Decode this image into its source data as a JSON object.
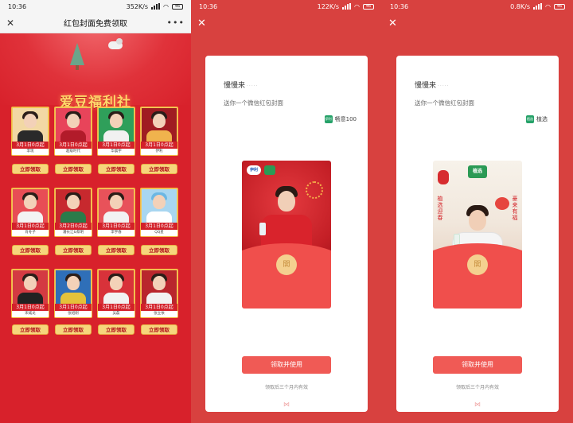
{
  "panels": {
    "left": {
      "status": {
        "time": "10:36",
        "speed": "352K/s",
        "battery": "46"
      },
      "title": "红包封面免费领取",
      "hero_title": "爱豆福利社",
      "cards": [
        {
          "date": "3月1日0点起",
          "name": "李现",
          "claim": "立即领取"
        },
        {
          "date": "3月1日0点起",
          "name": "超级时代",
          "claim": "立即领取"
        },
        {
          "date": "3月1日0点起",
          "name": "华晨宇",
          "claim": "立即领取"
        },
        {
          "date": "3月1日0点起",
          "name": "伊利",
          "claim": "立即领取"
        },
        {
          "date": "3月1日0点起",
          "name": "肖冬子",
          "claim": "立即领取"
        },
        {
          "date": "3月2日0点起",
          "name": "潘长江&蔡明",
          "claim": "立即领取"
        },
        {
          "date": "3月1日0点起",
          "name": "李宇春",
          "claim": "立即领取"
        },
        {
          "date": "3月1日0点起",
          "name": "QQ星",
          "claim": "立即领取"
        },
        {
          "date": "3月1日0点起",
          "name": "宋威龙",
          "claim": "立即领取"
        },
        {
          "date": "3月1日0点起",
          "name": "张绍刚",
          "claim": "立即领取"
        },
        {
          "date": "3月1日0点起",
          "name": "吴磊",
          "claim": "立即领取"
        },
        {
          "date": "3月1日0点起",
          "name": "张立依",
          "claim": "立即领取"
        }
      ]
    },
    "middle": {
      "status": {
        "time": "10:36",
        "speed": "122K/s",
        "battery": "46"
      },
      "brand": "慢慢来",
      "brand_dots": "·····",
      "subtitle": "送你一个微信红包封面",
      "sponsor": "畅意100",
      "sponsor_logo": "伊利",
      "cover_logo_text": "伊利",
      "coin_char": "開",
      "button": "领取并使用",
      "note": "领取后三个月内有效"
    },
    "right": {
      "status": {
        "time": "10:36",
        "speed": "0.8K/s",
        "battery": "46"
      },
      "brand": "慢慢来",
      "brand_dots": "·····",
      "subtitle": "送你一个微信红包封面",
      "sponsor": "植选",
      "sponsor_logo": "植选",
      "cover_logo_text": "植选",
      "deco_left": "植选迎春",
      "deco_right": "豪来有福",
      "coin_char": "開",
      "button": "领取并使用",
      "note": "领取后三个月内有效"
    }
  },
  "colors": {
    "red": "#d8212b",
    "gold": "#f3c75b",
    "button": "#f05a55"
  }
}
